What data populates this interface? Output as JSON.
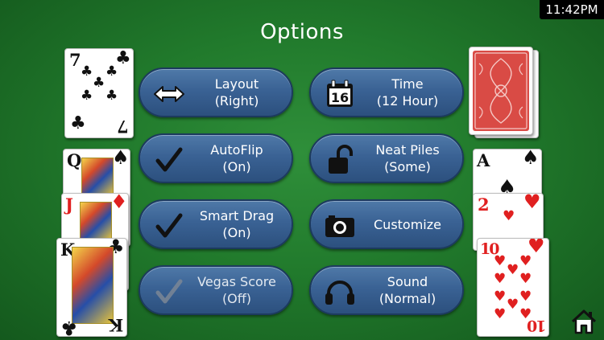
{
  "status": {
    "time": "11:42PM"
  },
  "page": {
    "title": "Options"
  },
  "options": [
    {
      "name": "layout",
      "label": "Layout",
      "value": "(Right)",
      "icon": "arrows-horizontal-icon"
    },
    {
      "name": "time",
      "label": "Time",
      "value": "(12 Hour)",
      "icon": "calendar-icon",
      "icon_text": "16"
    },
    {
      "name": "autoflip",
      "label": "AutoFlip",
      "value": "(On)",
      "icon": "checkmark-icon"
    },
    {
      "name": "neat-piles",
      "label": "Neat Piles",
      "value": "(Some)",
      "icon": "padlock-open-icon"
    },
    {
      "name": "smart-drag",
      "label": "Smart Drag",
      "value": "(On)",
      "icon": "checkmark-icon"
    },
    {
      "name": "customize",
      "label": "Customize",
      "value": "",
      "icon": "camera-icon"
    },
    {
      "name": "vegas-score",
      "label": "Vegas Score",
      "value": "(Off)",
      "icon": "checkmark-icon"
    },
    {
      "name": "sound",
      "label": "Sound",
      "value": "(Normal)",
      "icon": "headphones-icon"
    }
  ],
  "cards": {
    "seven_clubs": {
      "rank": "7",
      "suit": "♣"
    },
    "queen_spades": {
      "rank": "Q",
      "suit": "♠"
    },
    "jack_diamonds": {
      "rank": "J",
      "suit": "♦"
    },
    "king_clubs": {
      "rank": "K",
      "suit": "♣"
    },
    "ace_spades": {
      "rank": "A",
      "suit": "♠"
    },
    "two_hearts": {
      "rank": "2",
      "suit": "♥"
    },
    "ten_hearts": {
      "rank": "10",
      "suit": "♥"
    }
  },
  "colors": {
    "felt": "#217a2c",
    "button": "#3a6294",
    "card_back": "#d94b45"
  }
}
